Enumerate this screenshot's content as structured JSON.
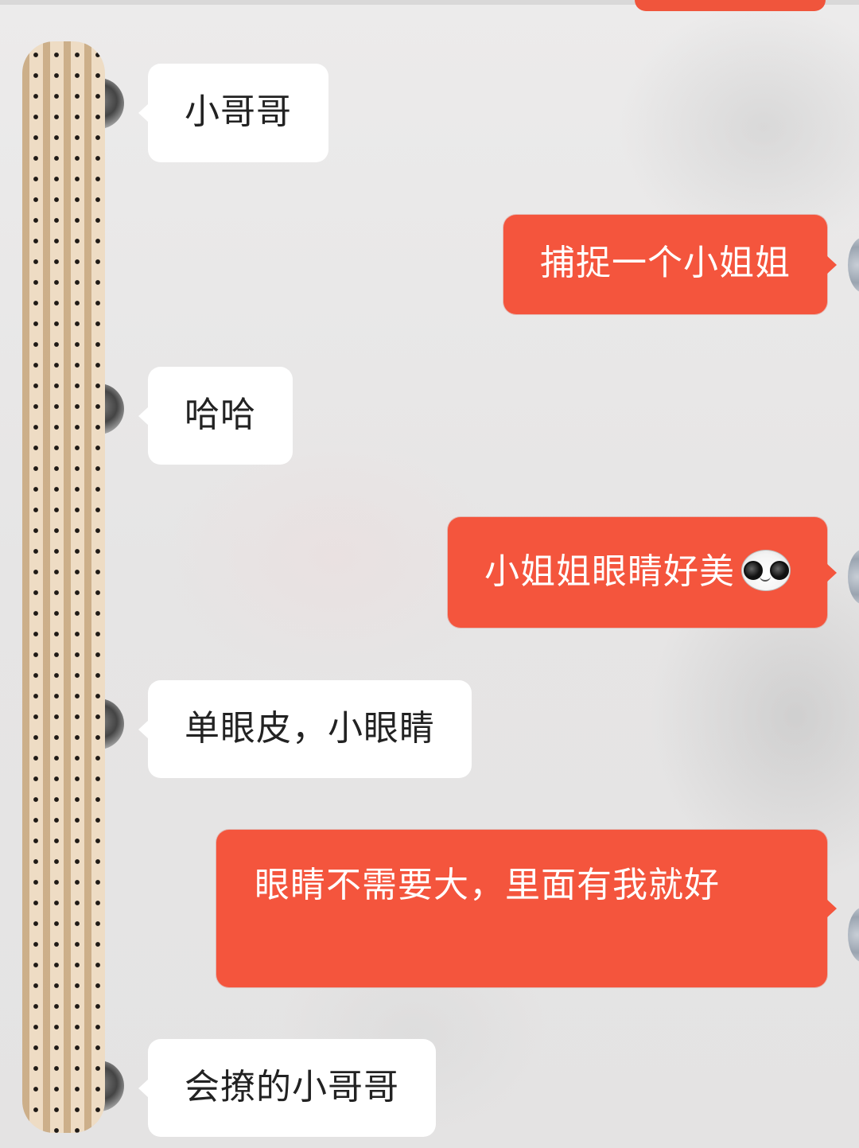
{
  "colors": {
    "sent_bubble": "#f4553d",
    "received_bubble": "#ffffff",
    "background": "#e9e8e8"
  },
  "messages": [
    {
      "side": "left",
      "text": "小哥哥"
    },
    {
      "side": "right",
      "text": "捕捉一个小姐姐"
    },
    {
      "side": "left",
      "text": "哈哈"
    },
    {
      "side": "right",
      "text": "小姐姐眼睛好美",
      "emoji": "wide-eyed-face-emoji"
    },
    {
      "side": "left",
      "text": "单眼皮，小眼睛"
    },
    {
      "side": "right",
      "text": "眼睛不需要大，里面有我就好"
    },
    {
      "side": "left",
      "text": "会撩的小哥哥"
    }
  ]
}
